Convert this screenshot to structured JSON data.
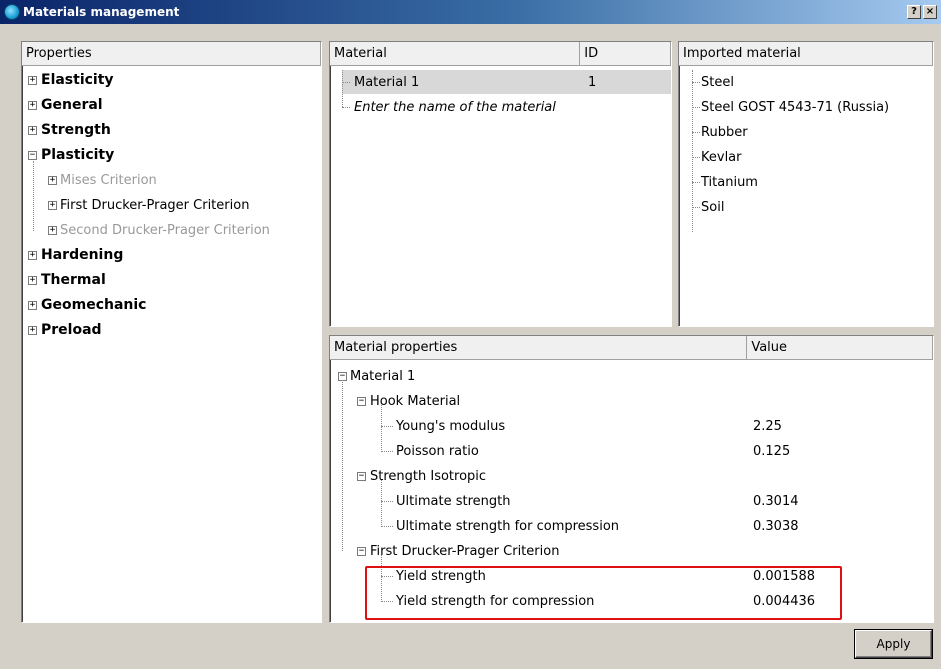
{
  "window": {
    "title": "Materials management",
    "help_button": "?",
    "close_button": "×"
  },
  "properties_panel": {
    "header": "Properties",
    "items": [
      {
        "label": "Elasticity",
        "expanded": false
      },
      {
        "label": "General",
        "expanded": false
      },
      {
        "label": "Strength",
        "expanded": false
      },
      {
        "label": "Plasticity",
        "expanded": true,
        "children": [
          {
            "label": "Mises Criterion",
            "enabled": false
          },
          {
            "label": "First Drucker-Prager Criterion",
            "enabled": true
          },
          {
            "label": "Second Drucker-Prager Criterion",
            "enabled": false
          }
        ]
      },
      {
        "label": "Hardening",
        "expanded": false
      },
      {
        "label": "Thermal",
        "expanded": false
      },
      {
        "label": "Geomechanic",
        "expanded": false
      },
      {
        "label": "Preload",
        "expanded": false
      }
    ]
  },
  "materials_panel": {
    "columns": [
      "Material",
      "ID"
    ],
    "rows": [
      {
        "name": "Material 1",
        "id": "1",
        "selected": true
      }
    ],
    "new_row_placeholder": "Enter the name of the material"
  },
  "imported_panel": {
    "header": "Imported material",
    "items": [
      "Steel",
      "Steel GOST 4543-71 (Russia)",
      "Rubber",
      "Kevlar",
      "Titanium",
      "Soil"
    ]
  },
  "properties_table": {
    "columns": [
      "Material properties",
      "Value"
    ],
    "root": "Material 1",
    "groups": [
      {
        "label": "Hook Material",
        "props": [
          {
            "name": "Young's modulus",
            "value": "2.25"
          },
          {
            "name": "Poisson ratio",
            "value": "0.125"
          }
        ]
      },
      {
        "label": "Strength Isotropic",
        "props": [
          {
            "name": "Ultimate strength",
            "value": "0.3014"
          },
          {
            "name": "Ultimate strength for compression",
            "value": "0.3038"
          }
        ]
      },
      {
        "label": "First Drucker-Prager Criterion",
        "props": [
          {
            "name": "Yield strength",
            "value": "0.001588"
          },
          {
            "name": "Yield strength for compression",
            "value": "0.004436"
          }
        ]
      }
    ]
  },
  "actions": {
    "apply_label": "Apply"
  },
  "colors": {
    "highlight": "#e01010",
    "selected_row": "#d8d8d8",
    "window_bg": "#d4d0c8"
  }
}
